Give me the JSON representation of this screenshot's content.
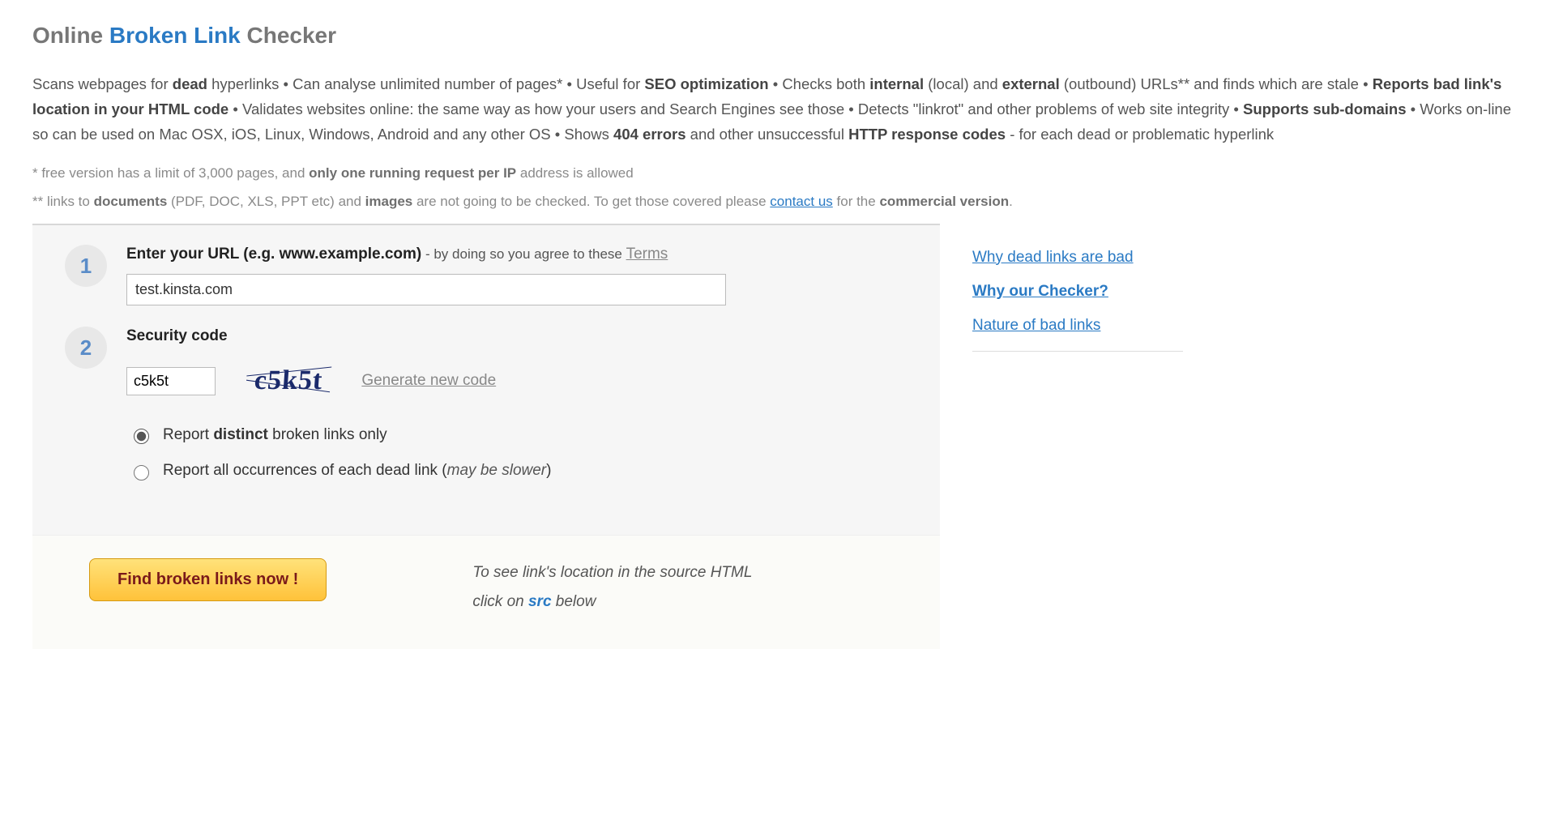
{
  "title": {
    "part1": "Online ",
    "highlight": "Broken Link",
    "part2": " Checker"
  },
  "description": {
    "t1": "Scans webpages for ",
    "b1": "dead",
    "t2": " hyperlinks • Can analyse unlimited number of pages* • Useful for ",
    "b2": "SEO optimization",
    "t3": " • Checks both ",
    "b3": "internal",
    "t4": " (local) and ",
    "b4": "external",
    "t5": " (outbound) URLs** and finds which are stale • ",
    "b5": "Reports bad link's location in your HTML code",
    "t6": " • Validates websites online: the same way as how your users and Search Engines see those • Detects \"linkrot\" and other problems of web site integrity • ",
    "b6": "Supports sub-domains",
    "t7": " • Works on-line so can be used on Mac OSX, iOS, Linux, Windows, Android and any other OS • Shows ",
    "b7": "404 errors",
    "t8": " and other unsuccessful ",
    "b8": "HTTP response codes",
    "t9": " - for each dead or problematic hyperlink"
  },
  "footnote1": {
    "prefix": "*  free version has a limit of 3,000 pages, and ",
    "bold": "only one running request per IP",
    "suffix": " address is allowed"
  },
  "footnote2": {
    "t1": "** links to ",
    "b1": "documents",
    "t2": " (PDF, DOC, XLS, PPT etc) and ",
    "b2": "images",
    "t3": " are not going to be checked. To get those covered please ",
    "link": "contact us",
    "t4": " for the ",
    "b3": "commercial version",
    "t5": "."
  },
  "form": {
    "step1_num": "1",
    "step1_label_bold": "Enter your URL (e.g. www.example.com)",
    "step1_label_sub": " - by doing so you agree to these ",
    "step1_terms": "Terms",
    "url_value": "test.kinsta.com",
    "step2_num": "2",
    "step2_label": "Security code",
    "code_value": "c5k5t",
    "captcha_text": "c5k5t",
    "gen_new": "Generate new code",
    "opt1_pre": "Report ",
    "opt1_bold": "distinct",
    "opt1_post": " broken links only",
    "opt2_pre": "Report all occurrences of each dead link (",
    "opt2_italic": "may be slower",
    "opt2_post": ")",
    "submit": "Find broken links now !",
    "hint_line1": "To see link's location in the source HTML",
    "hint_line2a": "click on ",
    "hint_src": "src",
    "hint_line2b": " below"
  },
  "sidebar": {
    "link1": "Why dead links are bad",
    "link2": "Why our Checker?",
    "link3": "Nature of bad links"
  }
}
